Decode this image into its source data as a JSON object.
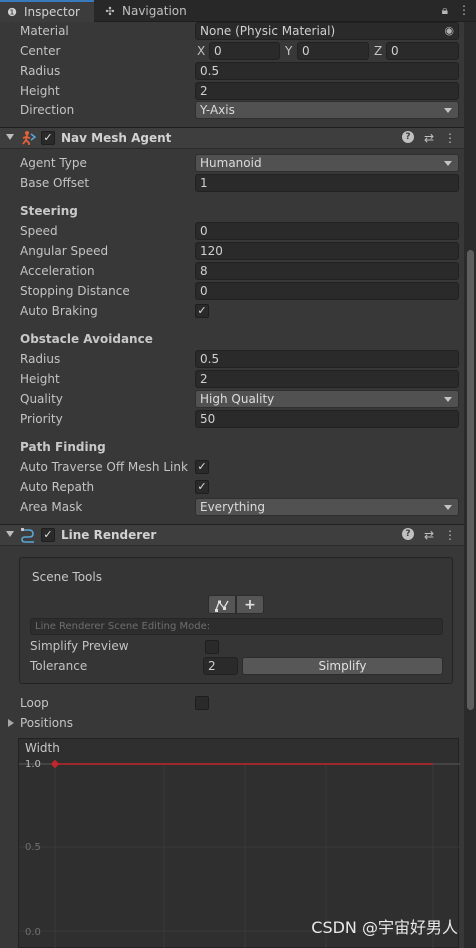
{
  "tabs": [
    {
      "label": "Inspector",
      "icon": "info-icon",
      "active": true
    },
    {
      "label": "Navigation",
      "icon": "navigation-icon",
      "active": false
    }
  ],
  "capsule_collider": {
    "material_label": "Material",
    "material_value": "None (Physic Material)",
    "center_label": "Center",
    "center_x_label": "X",
    "center_x": "0",
    "center_y_label": "Y",
    "center_y": "0",
    "center_z_label": "Z",
    "center_z": "0",
    "radius_label": "Radius",
    "radius": "0.5",
    "height_label": "Height",
    "height": "2",
    "direction_label": "Direction",
    "direction": "Y-Axis"
  },
  "nav_mesh_agent": {
    "title": "Nav Mesh Agent",
    "agent_type_label": "Agent Type",
    "agent_type": "Humanoid",
    "base_offset_label": "Base Offset",
    "base_offset": "1",
    "steering_heading": "Steering",
    "speed_label": "Speed",
    "speed": "0",
    "angular_speed_label": "Angular Speed",
    "angular_speed": "120",
    "acceleration_label": "Acceleration",
    "acceleration": "8",
    "stopping_distance_label": "Stopping Distance",
    "stopping_distance": "0",
    "auto_braking_label": "Auto Braking",
    "auto_braking": true,
    "obstacle_heading": "Obstacle Avoidance",
    "radius_label": "Radius",
    "radius": "0.5",
    "height_label": "Height",
    "height": "2",
    "quality_label": "Quality",
    "quality": "High Quality",
    "priority_label": "Priority",
    "priority": "50",
    "path_heading": "Path Finding",
    "auto_traverse_label": "Auto Traverse Off Mesh Link",
    "auto_traverse": true,
    "auto_repath_label": "Auto Repath",
    "auto_repath": true,
    "area_mask_label": "Area Mask",
    "area_mask": "Everything"
  },
  "line_renderer": {
    "title": "Line Renderer",
    "scene_tools_title": "Scene Tools",
    "edit_mode_placeholder": "Line Renderer Scene Editing Mode:",
    "simplify_preview_label": "Simplify Preview",
    "simplify_preview": false,
    "tolerance_label": "Tolerance",
    "tolerance": "2",
    "simplify_button": "Simplify",
    "loop_label": "Loop",
    "loop": false,
    "positions_label": "Positions",
    "width_label": "Width",
    "width_ticks": [
      "1.0",
      "0.5",
      "0.0"
    ],
    "width_value": 1.0
  },
  "watermark": "CSDN @宇宙好男人",
  "colors": {
    "accent": "#3a79bb",
    "curve": "#c0272d",
    "agent_icon": "#e2613a",
    "line_icon": "#5aa6d6"
  }
}
